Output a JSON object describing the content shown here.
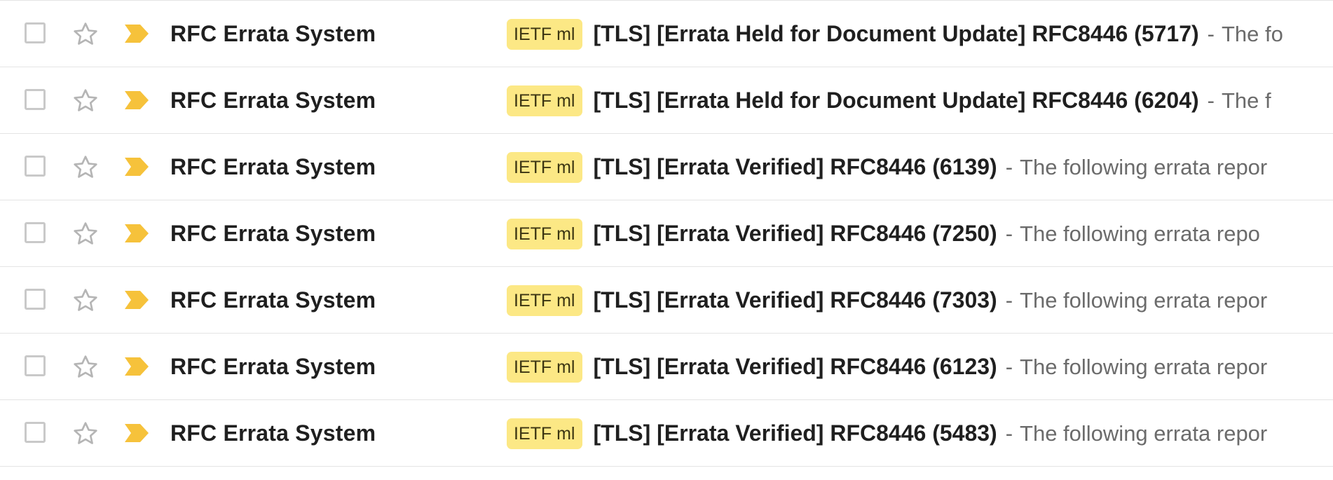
{
  "colors": {
    "label_bg": "#fce885",
    "importance": "#f6c23b",
    "divider": "#e4e4e4",
    "sender_text": "#1f1f1f",
    "snippet_text": "#6b6b6b"
  },
  "icons": {
    "checkbox": "checkbox-icon",
    "star": "star-outline-icon",
    "importance": "importance-marker-icon"
  },
  "emails": [
    {
      "sender": "RFC Errata System",
      "label": "IETF ml",
      "subject": "[TLS] [Errata Held for Document Update] RFC8446 (5717)",
      "separator": "-",
      "snippet": "The fo"
    },
    {
      "sender": "RFC Errata System",
      "label": "IETF ml",
      "subject": "[TLS] [Errata Held for Document Update] RFC8446 (6204)",
      "separator": "-",
      "snippet": "The f"
    },
    {
      "sender": "RFC Errata System",
      "label": "IETF ml",
      "subject": "[TLS] [Errata Verified] RFC8446 (6139)",
      "separator": "-",
      "snippet": "The following errata repor"
    },
    {
      "sender": "RFC Errata System",
      "label": "IETF ml",
      "subject": "[TLS] [Errata Verified] RFC8446 (7250)",
      "separator": "-",
      "snippet": "The following errata repo"
    },
    {
      "sender": "RFC Errata System",
      "label": "IETF ml",
      "subject": "[TLS] [Errata Verified] RFC8446 (7303)",
      "separator": "-",
      "snippet": "The following errata repor"
    },
    {
      "sender": "RFC Errata System",
      "label": "IETF ml",
      "subject": "[TLS] [Errata Verified] RFC8446 (6123)",
      "separator": "-",
      "snippet": "The following errata repor"
    },
    {
      "sender": "RFC Errata System",
      "label": "IETF ml",
      "subject": "[TLS] [Errata Verified] RFC8446 (5483)",
      "separator": "-",
      "snippet": "The following errata repor"
    }
  ]
}
